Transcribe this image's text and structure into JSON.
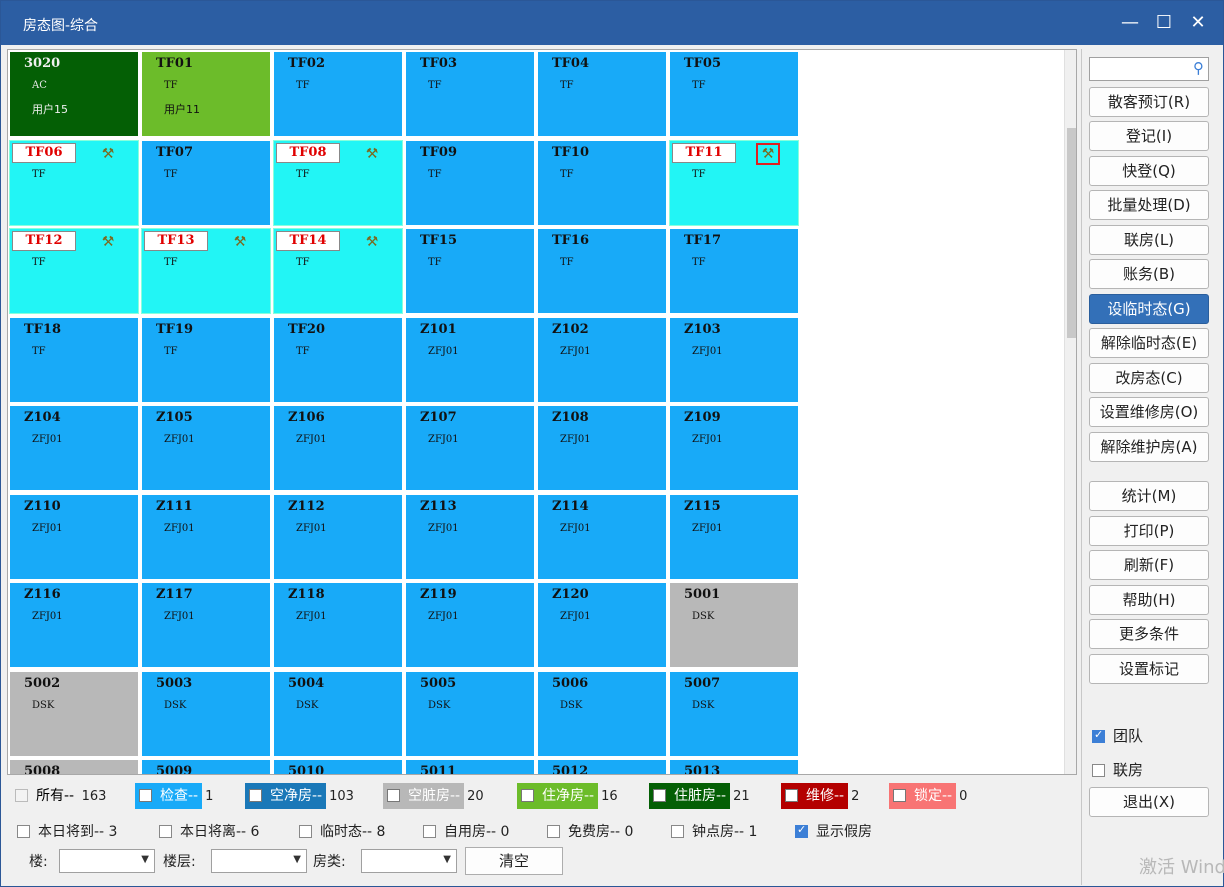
{
  "window": {
    "title": "房态图-综合",
    "controls": {
      "minimize": "—",
      "maximize": "☐",
      "close": "✕"
    }
  },
  "colors": {
    "vacant_clean": "#18aaf8",
    "vacant_dirty": "#b8b8b8",
    "occupied_clean": "#6cbc2a",
    "occupied_dirty": "#045f05",
    "temp_state": "#22f5f5",
    "inspect": "#18aaf8",
    "maintenance": "#b40000",
    "locked": "#f87474"
  },
  "rooms": [
    {
      "num": "3020",
      "type": "AC",
      "user": "用户15",
      "status": "occupied_dirty"
    },
    {
      "num": "TF01",
      "type": "TF",
      "user": "用户11",
      "status": "occupied_clean"
    },
    {
      "num": "TF02",
      "type": "TF",
      "status": "vacant_clean"
    },
    {
      "num": "TF03",
      "type": "TF",
      "status": "vacant_clean"
    },
    {
      "num": "TF04",
      "type": "TF",
      "status": "vacant_clean"
    },
    {
      "num": "TF05",
      "type": "TF",
      "status": "vacant_clean"
    },
    {
      "num": "TF06",
      "type": "TF",
      "status": "temp_state",
      "tool": true
    },
    {
      "num": "TF07",
      "type": "TF",
      "status": "vacant_clean"
    },
    {
      "num": "TF08",
      "type": "TF",
      "status": "temp_state",
      "tool": true
    },
    {
      "num": "TF09",
      "type": "TF",
      "status": "vacant_clean"
    },
    {
      "num": "TF10",
      "type": "TF",
      "status": "vacant_clean"
    },
    {
      "num": "TF11",
      "type": "TF",
      "status": "temp_state",
      "tool": true,
      "selected": true
    },
    {
      "num": "TF12",
      "type": "TF",
      "status": "temp_state",
      "tool": true
    },
    {
      "num": "TF13",
      "type": "TF",
      "status": "temp_state",
      "tool": true
    },
    {
      "num": "TF14",
      "type": "TF",
      "status": "temp_state",
      "tool": true
    },
    {
      "num": "TF15",
      "type": "TF",
      "status": "vacant_clean"
    },
    {
      "num": "TF16",
      "type": "TF",
      "status": "vacant_clean"
    },
    {
      "num": "TF17",
      "type": "TF",
      "status": "vacant_clean"
    },
    {
      "num": "TF18",
      "type": "TF",
      "status": "vacant_clean"
    },
    {
      "num": "TF19",
      "type": "TF",
      "status": "vacant_clean"
    },
    {
      "num": "TF20",
      "type": "TF",
      "status": "vacant_clean"
    },
    {
      "num": "Z101",
      "type": "ZFJ01",
      "status": "vacant_clean"
    },
    {
      "num": "Z102",
      "type": "ZFJ01",
      "status": "vacant_clean"
    },
    {
      "num": "Z103",
      "type": "ZFJ01",
      "status": "vacant_clean"
    },
    {
      "num": "Z104",
      "type": "ZFJ01",
      "status": "vacant_clean"
    },
    {
      "num": "Z105",
      "type": "ZFJ01",
      "status": "vacant_clean"
    },
    {
      "num": "Z106",
      "type": "ZFJ01",
      "status": "vacant_clean"
    },
    {
      "num": "Z107",
      "type": "ZFJ01",
      "status": "vacant_clean"
    },
    {
      "num": "Z108",
      "type": "ZFJ01",
      "status": "vacant_clean"
    },
    {
      "num": "Z109",
      "type": "ZFJ01",
      "status": "vacant_clean"
    },
    {
      "num": "Z110",
      "type": "ZFJ01",
      "status": "vacant_clean"
    },
    {
      "num": "Z111",
      "type": "ZFJ01",
      "status": "vacant_clean"
    },
    {
      "num": "Z112",
      "type": "ZFJ01",
      "status": "vacant_clean"
    },
    {
      "num": "Z113",
      "type": "ZFJ01",
      "status": "vacant_clean"
    },
    {
      "num": "Z114",
      "type": "ZFJ01",
      "status": "vacant_clean"
    },
    {
      "num": "Z115",
      "type": "ZFJ01",
      "status": "vacant_clean"
    },
    {
      "num": "Z116",
      "type": "ZFJ01",
      "status": "vacant_clean"
    },
    {
      "num": "Z117",
      "type": "ZFJ01",
      "status": "vacant_clean"
    },
    {
      "num": "Z118",
      "type": "ZFJ01",
      "status": "vacant_clean"
    },
    {
      "num": "Z119",
      "type": "ZFJ01",
      "status": "vacant_clean"
    },
    {
      "num": "Z120",
      "type": "ZFJ01",
      "status": "vacant_clean"
    },
    {
      "num": "5001",
      "type": "DSK",
      "status": "vacant_dirty"
    },
    {
      "num": "5002",
      "type": "DSK",
      "status": "vacant_dirty"
    },
    {
      "num": "5003",
      "type": "DSK",
      "status": "vacant_clean"
    },
    {
      "num": "5004",
      "type": "DSK",
      "status": "vacant_clean"
    },
    {
      "num": "5005",
      "type": "DSK",
      "status": "vacant_clean"
    },
    {
      "num": "5006",
      "type": "DSK",
      "status": "vacant_clean"
    },
    {
      "num": "5007",
      "type": "DSK",
      "status": "vacant_clean"
    },
    {
      "num": "5008",
      "status": "vacant_dirty"
    },
    {
      "num": "5009",
      "status": "vacant_clean"
    },
    {
      "num": "5010",
      "status": "vacant_clean"
    },
    {
      "num": "5011",
      "status": "vacant_clean"
    },
    {
      "num": "5012",
      "status": "vacant_clean"
    },
    {
      "num": "5013",
      "status": "vacant_clean"
    }
  ],
  "legend": {
    "all": {
      "label": "所有--",
      "count": "163"
    },
    "items": [
      {
        "key": "inspect",
        "label": "检查--",
        "count": "1",
        "color": "#18aaf8"
      },
      {
        "key": "vacant_clean",
        "label": "空净房--",
        "count": "103",
        "color": "#1a78b8"
      },
      {
        "key": "vacant_dirty",
        "label": "空脏房--",
        "count": "20",
        "color": "#b8b8b8"
      },
      {
        "key": "occupied_clean",
        "label": "住净房--",
        "count": "16",
        "color": "#6cbc2a"
      },
      {
        "key": "occupied_dirty",
        "label": "住脏房--",
        "count": "21",
        "color": "#045f05"
      },
      {
        "key": "maintenance",
        "label": "维修--",
        "count": "2",
        "color": "#b40000"
      },
      {
        "key": "locked",
        "label": "锁定--",
        "count": "0",
        "color": "#f87474"
      }
    ]
  },
  "filters_row": [
    {
      "label": "本日将到-- 3",
      "checked": false
    },
    {
      "label": "本日将离-- 6",
      "checked": false
    },
    {
      "label": "临时态-- 8",
      "checked": false
    },
    {
      "label": "自用房-- 0",
      "checked": false
    },
    {
      "label": "免费房-- 0",
      "checked": false
    },
    {
      "label": "钟点房-- 1",
      "checked": false
    },
    {
      "label": "显示假房",
      "checked": true
    }
  ],
  "selectors": {
    "building_label": "楼:",
    "floor_label": "楼层:",
    "roomtype_label": "房类:",
    "clear_label": "清空"
  },
  "panel": {
    "buttons": [
      {
        "label": "散客预订(R)"
      },
      {
        "label": "登记(I)"
      },
      {
        "label": "快登(Q)"
      },
      {
        "label": "批量处理(D)"
      },
      {
        "label": "联房(L)"
      },
      {
        "label": "账务(B)"
      },
      {
        "label": "设临时态(G)",
        "active": true
      },
      {
        "label": "解除临时态(E)"
      },
      {
        "label": "改房态(C)"
      },
      {
        "label": "设置维修房(O)"
      },
      {
        "label": "解除维护房(A)"
      },
      {
        "label": "统计(M)"
      },
      {
        "label": "打印(P)"
      },
      {
        "label": "刷新(F)"
      },
      {
        "label": "帮助(H)"
      },
      {
        "label": "更多条件"
      },
      {
        "label": "设置标记"
      }
    ],
    "group_label": "团队",
    "link_label": "联房",
    "exit_label": "退出(X)"
  },
  "watermark": "激活 Wind"
}
